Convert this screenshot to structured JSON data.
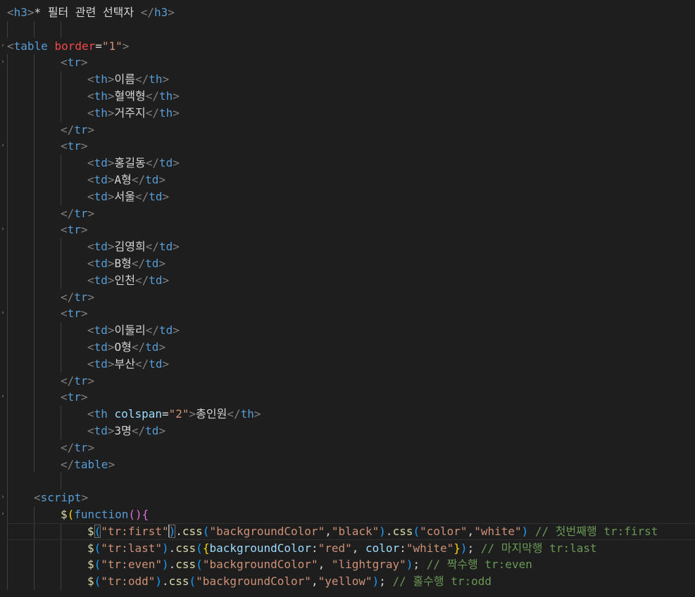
{
  "editor": {
    "lines": [
      {
        "indent": 0,
        "fold": false,
        "tokens": [
          {
            "c": "pun",
            "t": "<"
          },
          {
            "c": "tag",
            "t": "h3"
          },
          {
            "c": "pun",
            "t": ">"
          },
          {
            "c": "txt",
            "t": "* 필터 관련 선택자 "
          },
          {
            "c": "pun",
            "t": "</"
          },
          {
            "c": "tag",
            "t": "h3"
          },
          {
            "c": "pun",
            "t": ">"
          }
        ]
      },
      {
        "indent": 0,
        "fold": false,
        "tokens": []
      },
      {
        "indent": 0,
        "fold": true,
        "tokens": [
          {
            "c": "pun",
            "t": "<"
          },
          {
            "c": "tag",
            "t": "table"
          },
          {
            "c": "txt",
            "t": " "
          },
          {
            "c": "attr-red",
            "t": "border"
          },
          {
            "c": "txt",
            "t": "="
          },
          {
            "c": "str",
            "t": "\"1\""
          },
          {
            "c": "pun",
            "t": ">"
          }
        ]
      },
      {
        "indent": 2,
        "fold": true,
        "tokens": [
          {
            "c": "pun",
            "t": "<"
          },
          {
            "c": "tag",
            "t": "tr"
          },
          {
            "c": "pun",
            "t": ">"
          }
        ]
      },
      {
        "indent": 3,
        "fold": false,
        "tokens": [
          {
            "c": "pun",
            "t": "<"
          },
          {
            "c": "tag",
            "t": "th"
          },
          {
            "c": "pun",
            "t": ">"
          },
          {
            "c": "txt",
            "t": "이름"
          },
          {
            "c": "pun",
            "t": "</"
          },
          {
            "c": "tag",
            "t": "th"
          },
          {
            "c": "pun",
            "t": ">"
          }
        ]
      },
      {
        "indent": 3,
        "fold": false,
        "tokens": [
          {
            "c": "pun",
            "t": "<"
          },
          {
            "c": "tag",
            "t": "th"
          },
          {
            "c": "pun",
            "t": ">"
          },
          {
            "c": "txt",
            "t": "혈액형"
          },
          {
            "c": "pun",
            "t": "</"
          },
          {
            "c": "tag",
            "t": "th"
          },
          {
            "c": "pun",
            "t": ">"
          }
        ]
      },
      {
        "indent": 3,
        "fold": false,
        "tokens": [
          {
            "c": "pun",
            "t": "<"
          },
          {
            "c": "tag",
            "t": "th"
          },
          {
            "c": "pun",
            "t": ">"
          },
          {
            "c": "txt",
            "t": "거주지"
          },
          {
            "c": "pun",
            "t": "</"
          },
          {
            "c": "tag",
            "t": "th"
          },
          {
            "c": "pun",
            "t": ">"
          }
        ]
      },
      {
        "indent": 2,
        "fold": false,
        "tokens": [
          {
            "c": "pun",
            "t": "</"
          },
          {
            "c": "tag",
            "t": "tr"
          },
          {
            "c": "pun",
            "t": ">"
          }
        ]
      },
      {
        "indent": 2,
        "fold": true,
        "tokens": [
          {
            "c": "pun",
            "t": "<"
          },
          {
            "c": "tag",
            "t": "tr"
          },
          {
            "c": "pun",
            "t": ">"
          }
        ]
      },
      {
        "indent": 3,
        "fold": false,
        "tokens": [
          {
            "c": "pun",
            "t": "<"
          },
          {
            "c": "tag",
            "t": "td"
          },
          {
            "c": "pun",
            "t": ">"
          },
          {
            "c": "txt",
            "t": "홍길동"
          },
          {
            "c": "pun",
            "t": "</"
          },
          {
            "c": "tag",
            "t": "td"
          },
          {
            "c": "pun",
            "t": ">"
          }
        ]
      },
      {
        "indent": 3,
        "fold": false,
        "tokens": [
          {
            "c": "pun",
            "t": "<"
          },
          {
            "c": "tag",
            "t": "td"
          },
          {
            "c": "pun",
            "t": ">"
          },
          {
            "c": "txt",
            "t": "A형"
          },
          {
            "c": "pun",
            "t": "</"
          },
          {
            "c": "tag",
            "t": "td"
          },
          {
            "c": "pun",
            "t": ">"
          }
        ]
      },
      {
        "indent": 3,
        "fold": false,
        "tokens": [
          {
            "c": "pun",
            "t": "<"
          },
          {
            "c": "tag",
            "t": "td"
          },
          {
            "c": "pun",
            "t": ">"
          },
          {
            "c": "txt",
            "t": "서울"
          },
          {
            "c": "pun",
            "t": "</"
          },
          {
            "c": "tag",
            "t": "td"
          },
          {
            "c": "pun",
            "t": ">"
          }
        ]
      },
      {
        "indent": 2,
        "fold": false,
        "tokens": [
          {
            "c": "pun",
            "t": "</"
          },
          {
            "c": "tag",
            "t": "tr"
          },
          {
            "c": "pun",
            "t": ">"
          }
        ]
      },
      {
        "indent": 2,
        "fold": true,
        "tokens": [
          {
            "c": "pun",
            "t": "<"
          },
          {
            "c": "tag",
            "t": "tr"
          },
          {
            "c": "pun",
            "t": ">"
          }
        ]
      },
      {
        "indent": 3,
        "fold": false,
        "tokens": [
          {
            "c": "pun",
            "t": "<"
          },
          {
            "c": "tag",
            "t": "td"
          },
          {
            "c": "pun",
            "t": ">"
          },
          {
            "c": "txt",
            "t": "김영희"
          },
          {
            "c": "pun",
            "t": "</"
          },
          {
            "c": "tag",
            "t": "td"
          },
          {
            "c": "pun",
            "t": ">"
          }
        ]
      },
      {
        "indent": 3,
        "fold": false,
        "tokens": [
          {
            "c": "pun",
            "t": "<"
          },
          {
            "c": "tag",
            "t": "td"
          },
          {
            "c": "pun",
            "t": ">"
          },
          {
            "c": "txt",
            "t": "B형"
          },
          {
            "c": "pun",
            "t": "</"
          },
          {
            "c": "tag",
            "t": "td"
          },
          {
            "c": "pun",
            "t": ">"
          }
        ]
      },
      {
        "indent": 3,
        "fold": false,
        "tokens": [
          {
            "c": "pun",
            "t": "<"
          },
          {
            "c": "tag",
            "t": "td"
          },
          {
            "c": "pun",
            "t": ">"
          },
          {
            "c": "txt",
            "t": "인천"
          },
          {
            "c": "pun",
            "t": "</"
          },
          {
            "c": "tag",
            "t": "td"
          },
          {
            "c": "pun",
            "t": ">"
          }
        ]
      },
      {
        "indent": 2,
        "fold": false,
        "tokens": [
          {
            "c": "pun",
            "t": "</"
          },
          {
            "c": "tag",
            "t": "tr"
          },
          {
            "c": "pun",
            "t": ">"
          }
        ]
      },
      {
        "indent": 2,
        "fold": true,
        "tokens": [
          {
            "c": "pun",
            "t": "<"
          },
          {
            "c": "tag",
            "t": "tr"
          },
          {
            "c": "pun",
            "t": ">"
          }
        ]
      },
      {
        "indent": 3,
        "fold": false,
        "tokens": [
          {
            "c": "pun",
            "t": "<"
          },
          {
            "c": "tag",
            "t": "td"
          },
          {
            "c": "pun",
            "t": ">"
          },
          {
            "c": "txt",
            "t": "이둘리"
          },
          {
            "c": "pun",
            "t": "</"
          },
          {
            "c": "tag",
            "t": "td"
          },
          {
            "c": "pun",
            "t": ">"
          }
        ]
      },
      {
        "indent": 3,
        "fold": false,
        "tokens": [
          {
            "c": "pun",
            "t": "<"
          },
          {
            "c": "tag",
            "t": "td"
          },
          {
            "c": "pun",
            "t": ">"
          },
          {
            "c": "txt",
            "t": "O형"
          },
          {
            "c": "pun",
            "t": "</"
          },
          {
            "c": "tag",
            "t": "td"
          },
          {
            "c": "pun",
            "t": ">"
          }
        ]
      },
      {
        "indent": 3,
        "fold": false,
        "tokens": [
          {
            "c": "pun",
            "t": "<"
          },
          {
            "c": "tag",
            "t": "td"
          },
          {
            "c": "pun",
            "t": ">"
          },
          {
            "c": "txt",
            "t": "부산"
          },
          {
            "c": "pun",
            "t": "</"
          },
          {
            "c": "tag",
            "t": "td"
          },
          {
            "c": "pun",
            "t": ">"
          }
        ]
      },
      {
        "indent": 2,
        "fold": false,
        "tokens": [
          {
            "c": "pun",
            "t": "</"
          },
          {
            "c": "tag",
            "t": "tr"
          },
          {
            "c": "pun",
            "t": ">"
          }
        ]
      },
      {
        "indent": 2,
        "fold": true,
        "tokens": [
          {
            "c": "pun",
            "t": "<"
          },
          {
            "c": "tag",
            "t": "tr"
          },
          {
            "c": "pun",
            "t": ">"
          }
        ]
      },
      {
        "indent": 3,
        "fold": false,
        "tokens": [
          {
            "c": "pun",
            "t": "<"
          },
          {
            "c": "tag",
            "t": "th"
          },
          {
            "c": "txt",
            "t": " "
          },
          {
            "c": "attr",
            "t": "colspan"
          },
          {
            "c": "txt",
            "t": "="
          },
          {
            "c": "str",
            "t": "\"2\""
          },
          {
            "c": "pun",
            "t": ">"
          },
          {
            "c": "txt",
            "t": "총인원"
          },
          {
            "c": "pun",
            "t": "</"
          },
          {
            "c": "tag",
            "t": "th"
          },
          {
            "c": "pun",
            "t": ">"
          }
        ]
      },
      {
        "indent": 3,
        "fold": false,
        "tokens": [
          {
            "c": "pun",
            "t": "<"
          },
          {
            "c": "tag",
            "t": "td"
          },
          {
            "c": "pun",
            "t": ">"
          },
          {
            "c": "txt",
            "t": "3명"
          },
          {
            "c": "pun",
            "t": "</"
          },
          {
            "c": "tag",
            "t": "td"
          },
          {
            "c": "pun",
            "t": ">"
          }
        ]
      },
      {
        "indent": 2,
        "fold": false,
        "tokens": [
          {
            "c": "pun",
            "t": "</"
          },
          {
            "c": "tag",
            "t": "tr"
          },
          {
            "c": "pun",
            "t": ">"
          }
        ]
      },
      {
        "indent": 2,
        "fold": false,
        "tokens": [
          {
            "c": "pun",
            "t": "</"
          },
          {
            "c": "tag",
            "t": "table"
          },
          {
            "c": "pun",
            "t": ">"
          }
        ]
      },
      {
        "indent": 0,
        "fold": false,
        "tokens": []
      },
      {
        "indent": 1,
        "fold": true,
        "tokens": [
          {
            "c": "pun",
            "t": "<"
          },
          {
            "c": "tag",
            "t": "script"
          },
          {
            "c": "pun",
            "t": ">"
          }
        ]
      },
      {
        "indent": 2,
        "fold": true,
        "tokens": [
          {
            "c": "fn",
            "t": "$"
          },
          {
            "c": "b1",
            "t": "("
          },
          {
            "c": "kw",
            "t": "function"
          },
          {
            "c": "b2",
            "t": "()"
          },
          {
            "c": "b2",
            "t": "{"
          }
        ]
      },
      {
        "indent": 3,
        "fold": false,
        "current": true,
        "tokens": [
          {
            "c": "fn",
            "t": "$"
          },
          {
            "c": "b3",
            "t": "(",
            "box": true
          },
          {
            "c": "str",
            "t": "\"tr:first\""
          },
          {
            "c": "b3",
            "t": ")",
            "box": true,
            "cursor": true
          },
          {
            "c": "txt",
            "t": "."
          },
          {
            "c": "fn",
            "t": "css"
          },
          {
            "c": "b3",
            "t": "("
          },
          {
            "c": "str",
            "t": "\"backgroundColor\""
          },
          {
            "c": "txt",
            "t": ","
          },
          {
            "c": "str",
            "t": "\"black\""
          },
          {
            "c": "b3",
            "t": ")"
          },
          {
            "c": "txt",
            "t": "."
          },
          {
            "c": "fn",
            "t": "css"
          },
          {
            "c": "b3",
            "t": "("
          },
          {
            "c": "str",
            "t": "\"color\""
          },
          {
            "c": "txt",
            "t": ","
          },
          {
            "c": "str",
            "t": "\"white\""
          },
          {
            "c": "b3",
            "t": ")"
          },
          {
            "c": "txt",
            "t": " "
          },
          {
            "c": "cmt",
            "t": "// 첫번째행 tr:first"
          }
        ]
      },
      {
        "indent": 3,
        "fold": false,
        "tokens": [
          {
            "c": "fn",
            "t": "$"
          },
          {
            "c": "b3",
            "t": "("
          },
          {
            "c": "str",
            "t": "\"tr:last\""
          },
          {
            "c": "b3",
            "t": ")"
          },
          {
            "c": "txt",
            "t": "."
          },
          {
            "c": "fn",
            "t": "css"
          },
          {
            "c": "b3",
            "t": "("
          },
          {
            "c": "b1",
            "t": "{"
          },
          {
            "c": "prop",
            "t": "backgroundColor"
          },
          {
            "c": "txt",
            "t": ":"
          },
          {
            "c": "str",
            "t": "\"red\""
          },
          {
            "c": "txt",
            "t": ", "
          },
          {
            "c": "prop",
            "t": "color"
          },
          {
            "c": "txt",
            "t": ":"
          },
          {
            "c": "str",
            "t": "\"white\""
          },
          {
            "c": "b1",
            "t": "}"
          },
          {
            "c": "b3",
            "t": ")"
          },
          {
            "c": "txt",
            "t": "; "
          },
          {
            "c": "cmt",
            "t": "// 마지막행 tr:last"
          }
        ]
      },
      {
        "indent": 3,
        "fold": false,
        "tokens": [
          {
            "c": "fn",
            "t": "$"
          },
          {
            "c": "b3",
            "t": "("
          },
          {
            "c": "str",
            "t": "\"tr:even\""
          },
          {
            "c": "b3",
            "t": ")"
          },
          {
            "c": "txt",
            "t": "."
          },
          {
            "c": "fn",
            "t": "css"
          },
          {
            "c": "b3",
            "t": "("
          },
          {
            "c": "str",
            "t": "\"backgroundColor\""
          },
          {
            "c": "txt",
            "t": ", "
          },
          {
            "c": "str",
            "t": "\"lightgray\""
          },
          {
            "c": "b3",
            "t": ")"
          },
          {
            "c": "txt",
            "t": "; "
          },
          {
            "c": "cmt",
            "t": "// 짝수행 tr:even"
          }
        ]
      },
      {
        "indent": 3,
        "fold": false,
        "tokens": [
          {
            "c": "fn",
            "t": "$"
          },
          {
            "c": "b3",
            "t": "("
          },
          {
            "c": "str",
            "t": "\"tr:odd\""
          },
          {
            "c": "b3",
            "t": ")"
          },
          {
            "c": "txt",
            "t": "."
          },
          {
            "c": "fn",
            "t": "css"
          },
          {
            "c": "b3",
            "t": "("
          },
          {
            "c": "str",
            "t": "\"backgroundColor\""
          },
          {
            "c": "txt",
            "t": ","
          },
          {
            "c": "str",
            "t": "\"yellow\""
          },
          {
            "c": "b3",
            "t": ")"
          },
          {
            "c": "txt",
            "t": "; "
          },
          {
            "c": "cmt",
            "t": "// 홀수행 tr:odd"
          }
        ]
      }
    ]
  },
  "theme": {
    "background": "#1e1e1e",
    "tag": "#569cd6",
    "attribute": "#9cdcfe",
    "string": "#ce9178",
    "comment": "#6a9955",
    "function": "#dcdcaa",
    "punctuation": "#808080",
    "text": "#d4d4d4"
  },
  "icons": {
    "fold": "chevron-right-icon"
  }
}
